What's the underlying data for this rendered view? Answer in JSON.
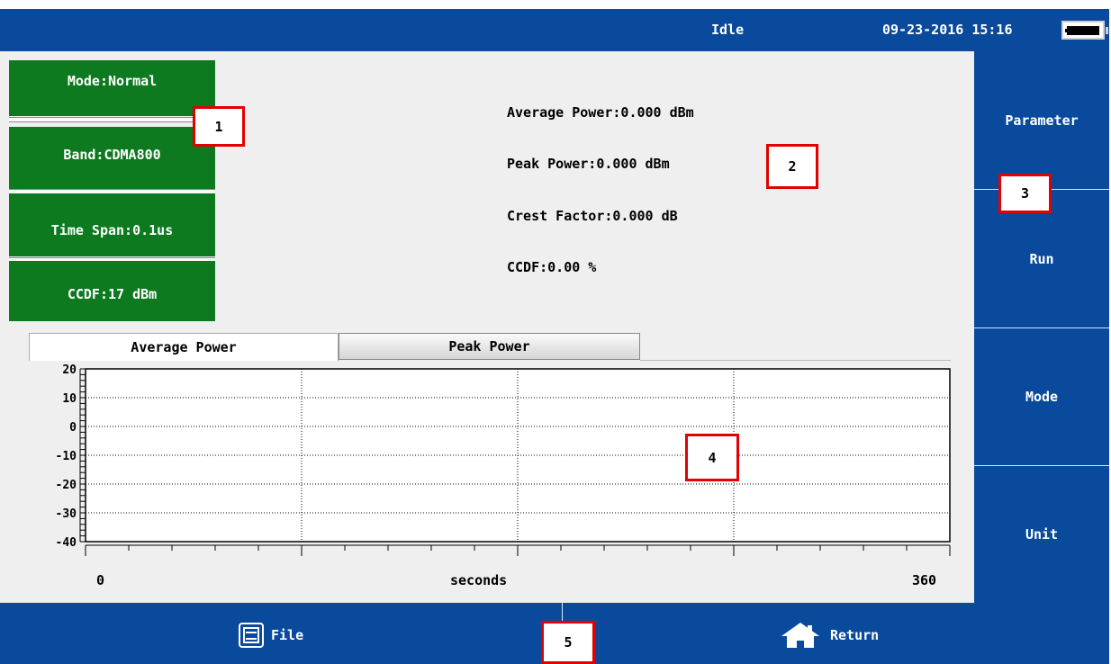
{
  "header": {
    "status": "Idle",
    "datetime": "09-23-2016 15:16",
    "battery_icon": "battery-charging-icon"
  },
  "left_panel": {
    "mode": "Mode:Normal",
    "band": "Band:CDMA800",
    "time_span": "Time Span:0.1us",
    "ccdf": "CCDF:17 dBm"
  },
  "readouts": {
    "average_power": "Average Power:0.000 dBm",
    "peak_power": "Peak Power:0.000 dBm",
    "crest_factor": "Crest Factor:0.000 dB",
    "ccdf": "CCDF:0.00 %"
  },
  "softkeys": [
    "Parameter",
    "Run",
    "Mode",
    "Unit"
  ],
  "tabs": {
    "active": "Average Power",
    "inactive": "Peak Power"
  },
  "markers": [
    "1",
    "2",
    "3",
    "4",
    "5"
  ],
  "chart_data": {
    "type": "line",
    "y_ticks": [
      "20",
      "10",
      "0",
      "-10",
      "-20",
      "-30",
      "-40"
    ],
    "ylim": [
      -40,
      20
    ],
    "xlim": [
      0,
      360
    ],
    "x_start": "0",
    "x_end": "360",
    "xlabel": "seconds",
    "grid": true,
    "series": []
  },
  "footer": {
    "file_label": "File",
    "return_label": "Return"
  },
  "colors": {
    "bar_blue": "#0a4a9c",
    "button_green": "#0d7a1f",
    "marker_red": "#e20000"
  }
}
